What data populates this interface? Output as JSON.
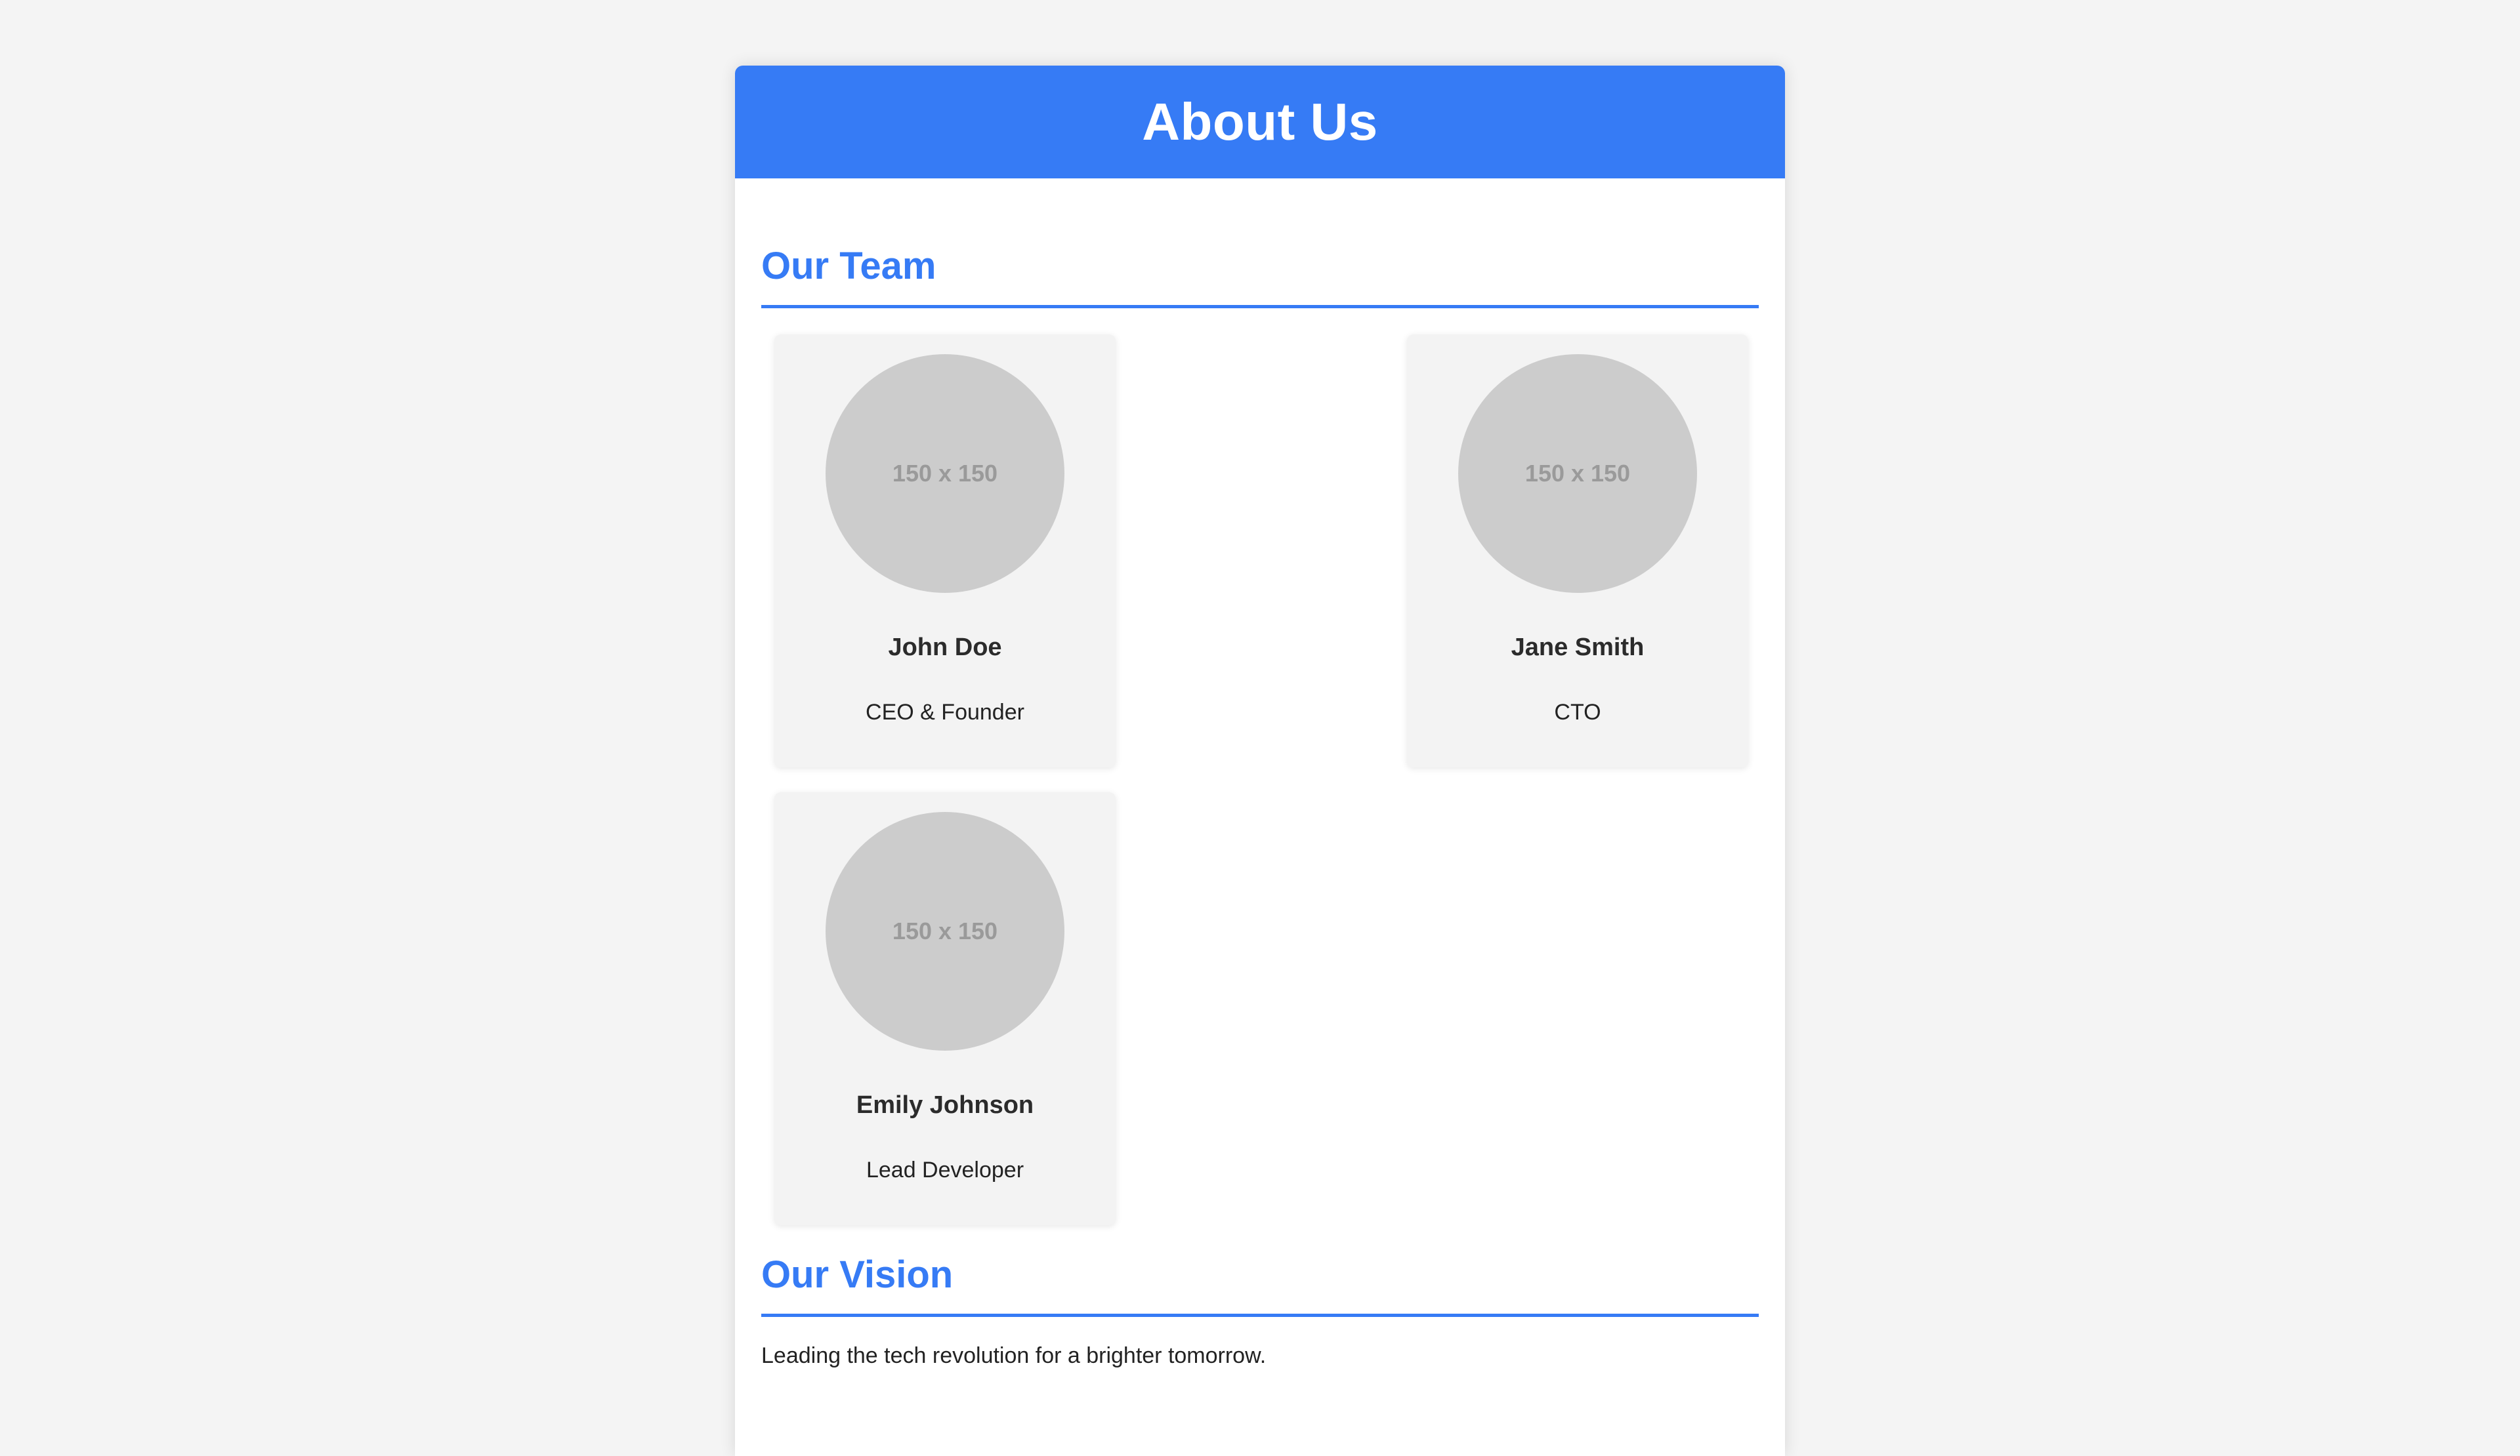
{
  "page": {
    "title": "About Us"
  },
  "sections": {
    "team": {
      "title": "Our Team",
      "members": [
        {
          "name": "John Doe",
          "role": "CEO & Founder",
          "avatar_text": "150 x 150"
        },
        {
          "name": "Jane Smith",
          "role": "CTO",
          "avatar_text": "150 x 150"
        },
        {
          "name": "Emily Johnson",
          "role": "Lead Developer",
          "avatar_text": "150 x 150"
        }
      ]
    },
    "vision": {
      "title": "Our Vision",
      "text": "Leading the tech revolution for a brighter tomorrow."
    }
  },
  "colors": {
    "accent": "#367bf5",
    "page_background": "#f4f4f4",
    "card_background": "#f3f3f3",
    "avatar_placeholder": "#cccccc"
  }
}
